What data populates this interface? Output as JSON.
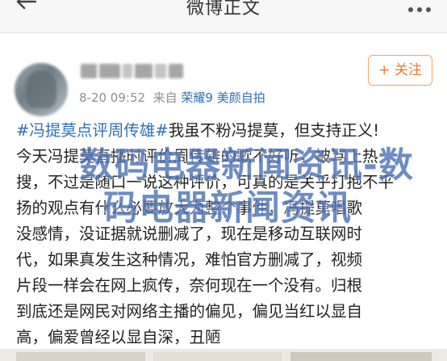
{
  "nav": {
    "title": "微博正文"
  },
  "post": {
    "meta_time": "8-20 09:52",
    "meta_from": "来自",
    "meta_client": "荣耀9 美颜自拍",
    "follow_label": "+ 关注",
    "lines": [
      [
        {
          "t": "#冯提莫点评周传雄#",
          "h": true
        },
        {
          "t": "我虽不粉冯提莫，但支持正义!",
          "h": false
        }
      ],
      [
        {
          "t": "今天冯提莫直播时评价周传雄的歌不好听，被骂上热",
          "h": false
        }
      ],
      [
        {
          "t": "搜，不过是随口一说这种评价，可真的是关乎打抱不平",
          "h": false
        }
      ],
      [
        {
          "t": "扬的观点有什么必要放大为整个事件，冯提莫唱歌",
          "h": false
        }
      ],
      [
        {
          "t": "没感情，没证据就说删减了，现在是移动互联网时",
          "h": false
        }
      ],
      [
        {
          "t": "代，如果真发生这种情况，难怕官方删减了，视频",
          "h": false
        }
      ],
      [
        {
          "t": "片段一样会在网上疯传，奈何现在一个没有。归根",
          "h": false
        }
      ],
      [
        {
          "t": "到底还是网民对网络主播的偏见，偏见当红以显自",
          "h": false
        }
      ],
      [
        {
          "t": "高，偏爱曾经以显自深，丑陋",
          "h": false
        }
      ]
    ]
  },
  "watermark": {
    "line1": "数码电器新闻资讯-数",
    "line2": "码电器新闻资讯"
  }
}
